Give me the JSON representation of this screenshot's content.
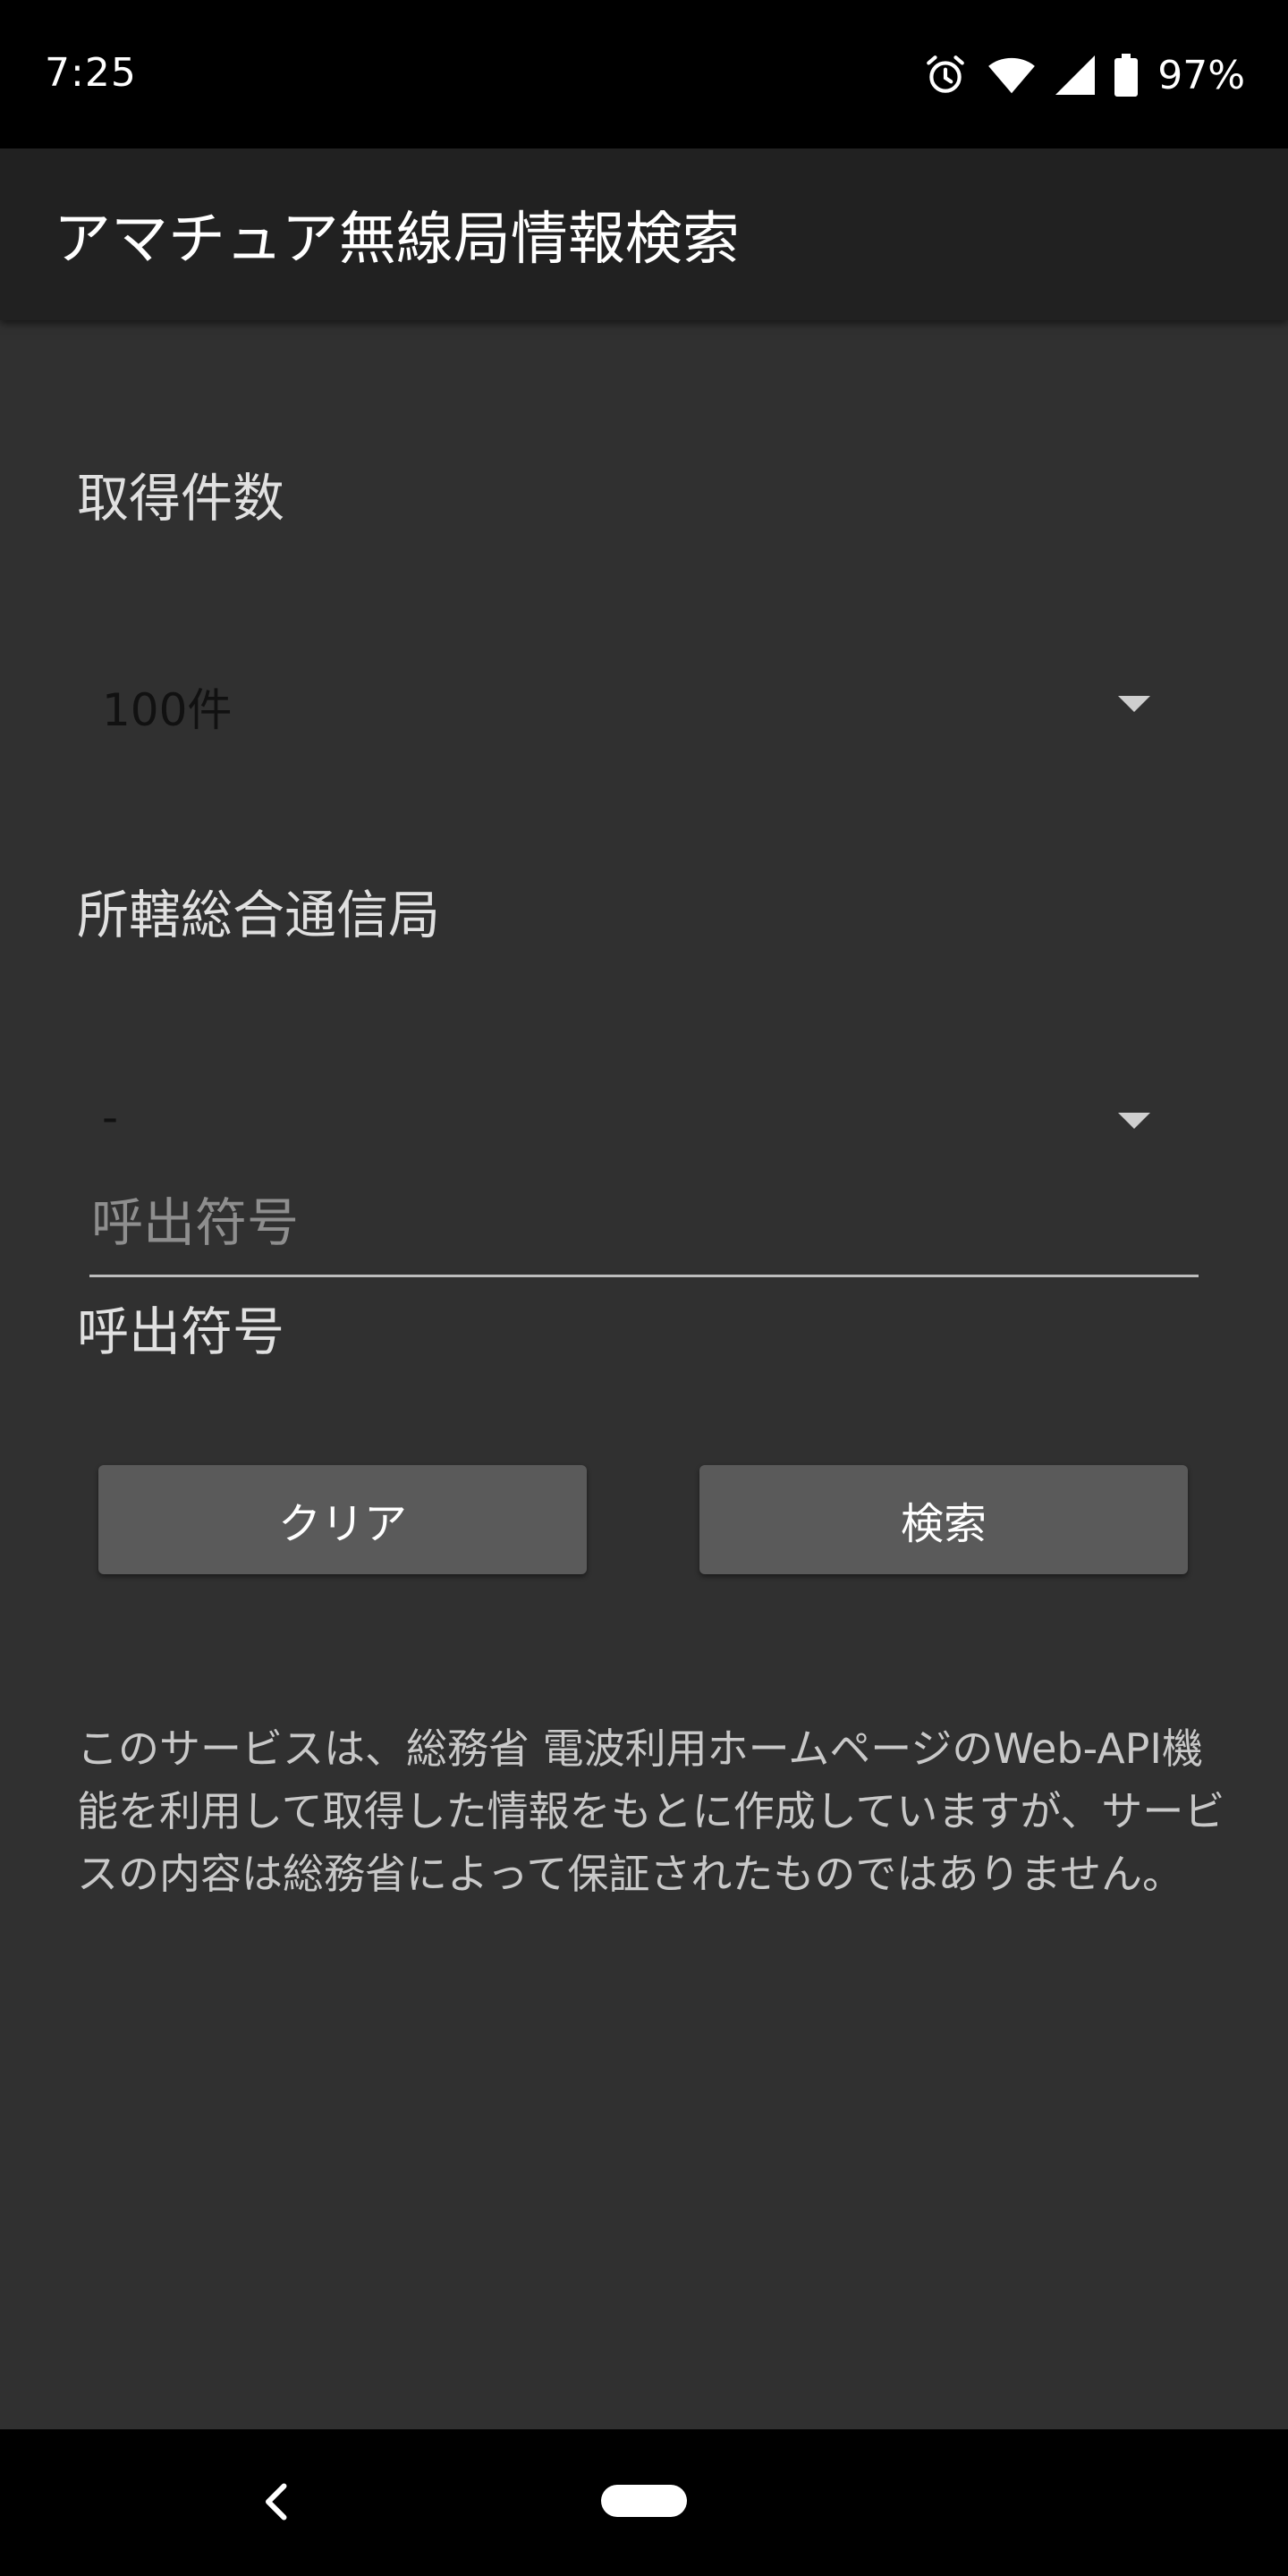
{
  "status_bar": {
    "time": "7:25",
    "battery_percent": "97%",
    "icons": [
      "alarm-icon",
      "wifi-icon",
      "signal-icon",
      "battery-icon"
    ]
  },
  "app_bar": {
    "title": "アマチュア無線局情報検索"
  },
  "form": {
    "count": {
      "label": "取得件数",
      "selected": "100件"
    },
    "bureau": {
      "label": "所轄総合通信局",
      "selected": "-"
    },
    "callsign": {
      "label": "呼出符号",
      "value": "",
      "placeholder": "呼出符号"
    },
    "buttons": {
      "clear": "クリア",
      "search": "検索"
    }
  },
  "disclaimer": "このサービスは、総務省 電波利用ホームページのWeb-API機能を利用して取得した情報をもとに作成していますが、サービスの内容は総務省によって保証されたものではありません。",
  "nav_bar": {
    "icons": [
      "back-icon",
      "home-pill-icon"
    ]
  },
  "colors": {
    "background": "#303030",
    "app_bar": "#212121",
    "button": "#5a5a5a",
    "system_bars": "#000000"
  }
}
